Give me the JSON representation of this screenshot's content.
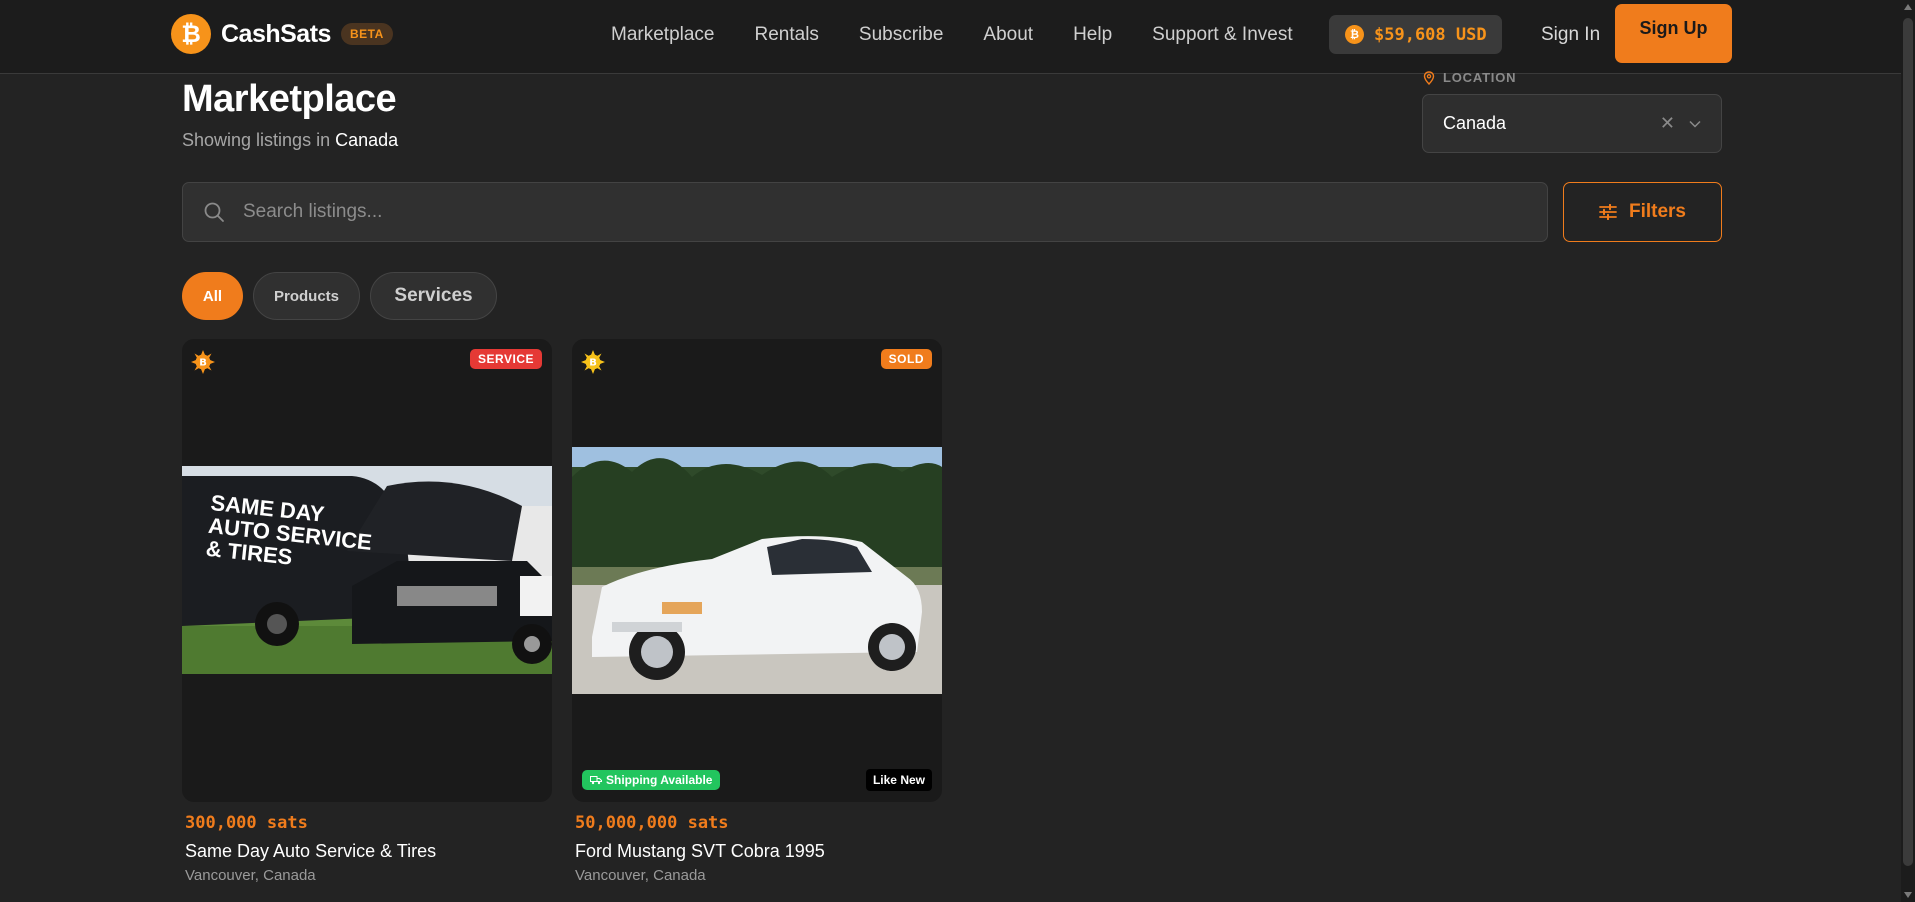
{
  "header": {
    "brand_name": "CashSats",
    "brand_logo_glyph": "₿",
    "beta_label": "BETA",
    "nav": [
      "Marketplace",
      "Rentals",
      "Subscribe",
      "About",
      "Help",
      "Support & Invest"
    ],
    "price_coin_glyph": "₿",
    "btc_price": "$59,608 USD",
    "sign_in": "Sign In",
    "sign_up": "Sign Up"
  },
  "page": {
    "title": "Marketplace",
    "subtitle_prefix": "Showing listings in",
    "subtitle_location": "Canada"
  },
  "location": {
    "label": "LOCATION",
    "value": "Canada",
    "clear_glyph": "✕"
  },
  "search": {
    "placeholder": "Search listings...",
    "value": ""
  },
  "filters_label": "Filters",
  "chips": {
    "all": "All",
    "products": "Products",
    "services": "Services",
    "selected": "All"
  },
  "listings": [
    {
      "tag": "SERVICE",
      "photo_text": [
        "SAME DAY",
        "AUTO SERVICE",
        "& TIRES"
      ],
      "price": "300,000 sats",
      "title": "Same Day Auto Service & Tires",
      "location": "Vancouver, Canada"
    },
    {
      "tag": "SOLD",
      "shipping": "Shipping Available",
      "condition": "Like New",
      "price": "50,000,000 sats",
      "title": "Ford Mustang SVT Cobra 1995",
      "location": "Vancouver, Canada"
    }
  ],
  "colors": {
    "accent": "#f07c1c",
    "bitcoin": "#f7931a",
    "service_tag": "#e53935",
    "shipping": "#22c55e",
    "background": "#232323"
  },
  "icons": {
    "logo": "bitcoin-logo-icon",
    "location": "map-pin-icon",
    "search": "search-icon",
    "filters": "sliders-icon",
    "chevron": "chevron-down-icon",
    "clear": "close-icon",
    "seller": "bitcoin-sun-icon",
    "shipping": "truck-icon"
  }
}
